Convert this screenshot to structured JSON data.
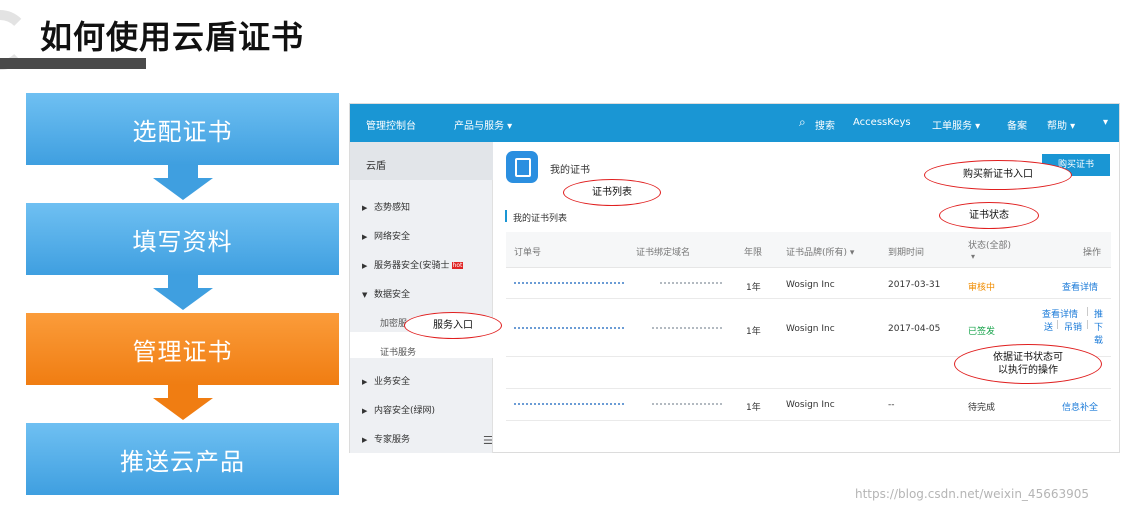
{
  "slide_title": "如何使用云盾证书",
  "steps": [
    "选配证书",
    "填写资料",
    "管理证书",
    "推送云产品"
  ],
  "colors": {
    "step_blue": "#3f9fe0",
    "step_orange": "#f07d12",
    "topbar": "#1a96d4",
    "callout_border": "#e01f1f"
  },
  "topbar": {
    "console": "管理控制台",
    "products": "产品与服务 ▾",
    "search_icon": "search-icon",
    "search": "搜索",
    "access_keys": "AccessKeys",
    "tickets": "工单服务 ▾",
    "filing": "备案",
    "help": "帮助 ▾",
    "more": "▾"
  },
  "sidebar": {
    "header": "云盾",
    "items": {
      "situation": "态势感知",
      "network": "网络安全",
      "server": "服务器安全(安骑士",
      "server_badge": "hot",
      "data": "数据安全",
      "encrypt": "加密服",
      "cert": "证书服务",
      "business": "业务安全",
      "content": "内容安全(绿网)",
      "expert": "专家服务"
    }
  },
  "main": {
    "page_title": "我的证书",
    "buy_button": "购买证书",
    "section_title": "我的证书列表",
    "columns": [
      "订单号",
      "证书绑定域名",
      "年限",
      "证书品牌(所有) ▾",
      "到期时间",
      "状态(全部)",
      "操作"
    ],
    "rows": [
      {
        "years": "1年",
        "brand": "Wosign Inc",
        "expiry": "2017-03-31",
        "status": "审核中",
        "ops": [
          "查看详情"
        ]
      },
      {
        "years": "1年",
        "brand": "Wosign Inc",
        "expiry": "2017-04-05",
        "status": "已签发",
        "ops": [
          "查看详情",
          "推",
          "送",
          "吊销",
          "下",
          "载"
        ]
      },
      {
        "years": "1年",
        "brand": "Wosign Inc",
        "expiry": "--",
        "status": "待完成",
        "ops": [
          "信息补全"
        ]
      }
    ]
  },
  "callouts": {
    "buy_entry": "购买新证书入口",
    "cert_list": "证书列表",
    "cert_status": "证书状态",
    "service_entry": "服务入口",
    "ops_line1": "依据证书状态可",
    "ops_line2": "以执行的操作"
  },
  "watermark": "https://blog.csdn.net/weixin_45663905"
}
